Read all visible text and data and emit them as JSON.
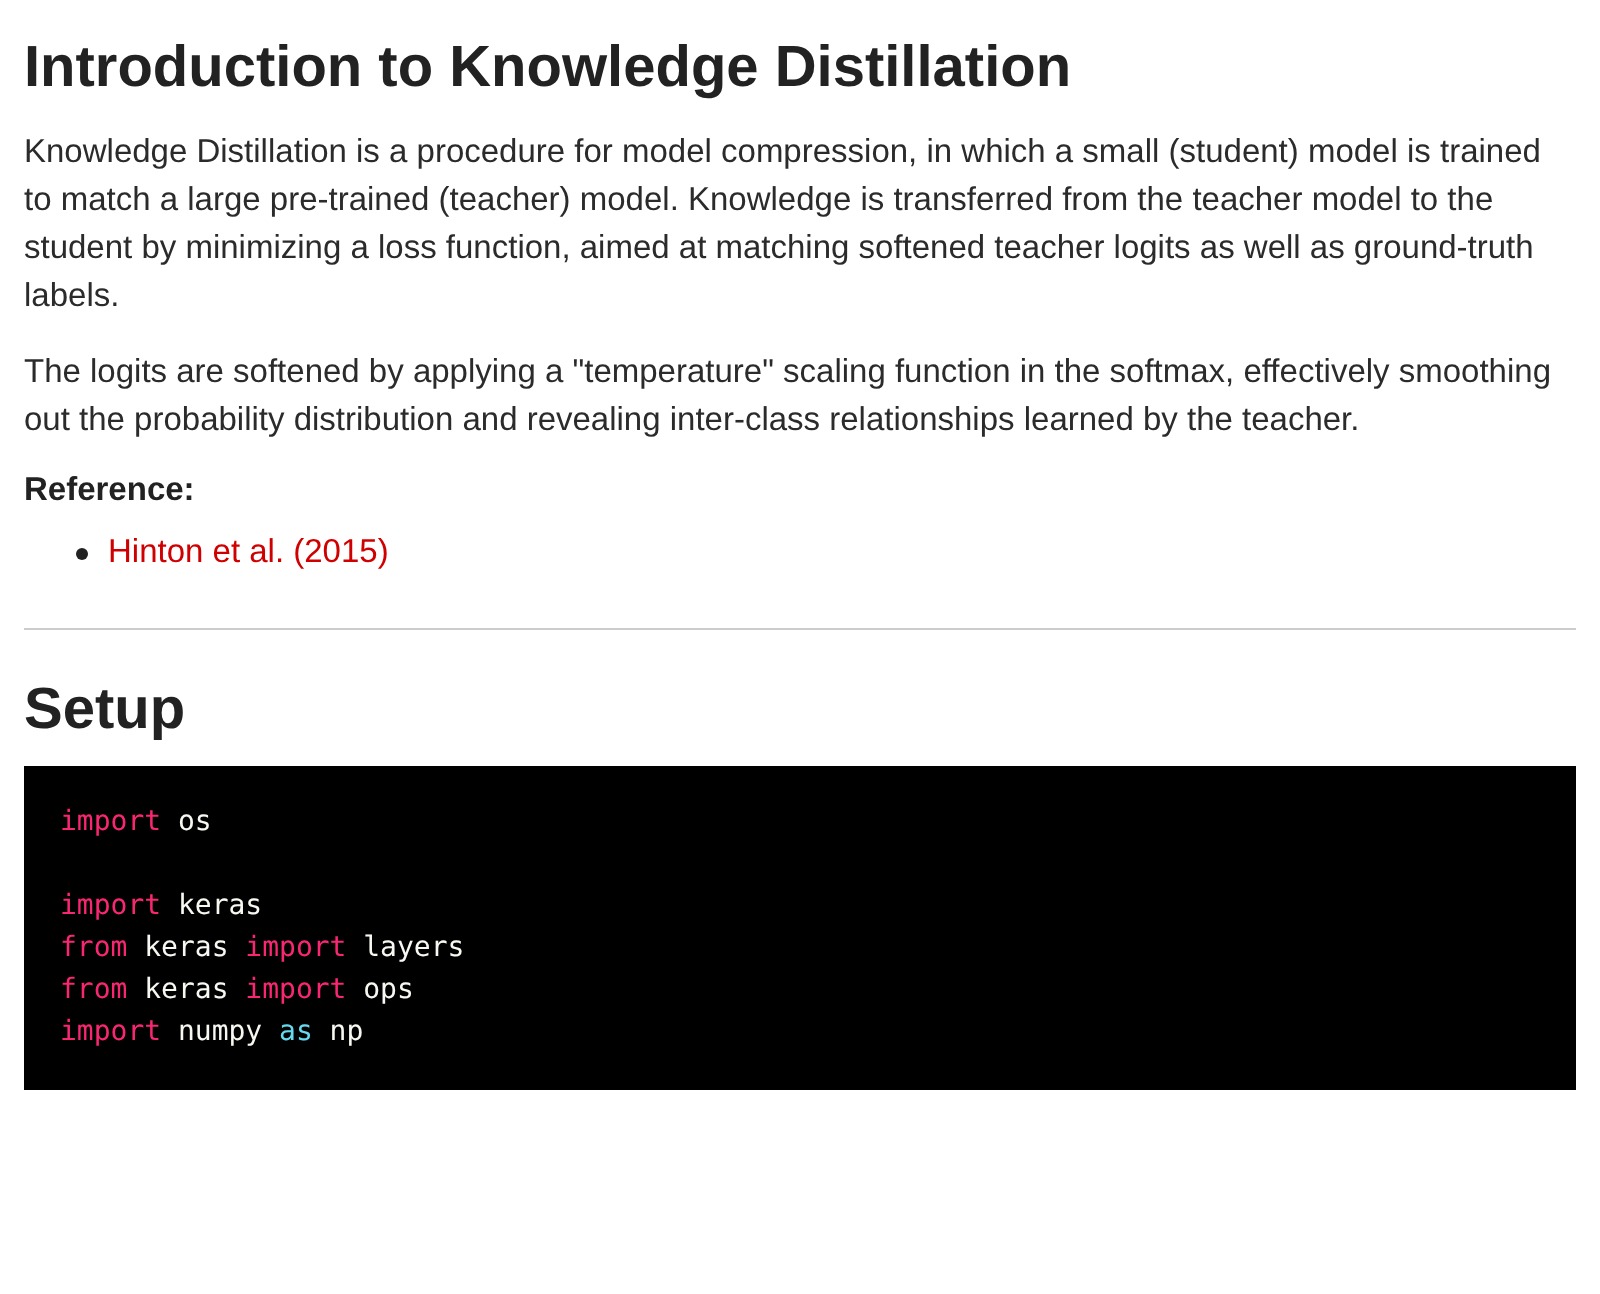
{
  "sections": [
    {
      "heading": "Introduction to Knowledge Distillation",
      "paragraphs": [
        "Knowledge Distillation is a procedure for model compression, in which a small (student) model is trained to match a large pre-trained (teacher) model. Knowledge is transferred from the teacher model to the student by minimizing a loss function, aimed at matching softened teacher logits as well as ground-truth labels.",
        "The logits are softened by applying a \"temperature\" scaling function in the softmax, effectively smoothing out the probability distribution and revealing inter-class relationships learned by the teacher."
      ],
      "reference": {
        "label": "Reference:",
        "links": [
          "Hinton et al. (2015)"
        ]
      }
    },
    {
      "heading": "Setup",
      "code": [
        {
          "kind": "code",
          "tokens": [
            {
              "kind": "keyword",
              "text": "import"
            },
            {
              "kind": "name",
              "text": "os"
            }
          ]
        },
        {
          "kind": "blank"
        },
        {
          "kind": "code",
          "tokens": [
            {
              "kind": "keyword",
              "text": "import"
            },
            {
              "kind": "name",
              "text": "keras"
            }
          ]
        },
        {
          "kind": "code",
          "tokens": [
            {
              "kind": "keyword",
              "text": "from"
            },
            {
              "kind": "name",
              "text": "keras"
            },
            {
              "kind": "keyword",
              "text": "import"
            },
            {
              "kind": "name",
              "text": "layers"
            }
          ]
        },
        {
          "kind": "code",
          "tokens": [
            {
              "kind": "keyword",
              "text": "from"
            },
            {
              "kind": "name",
              "text": "keras"
            },
            {
              "kind": "keyword",
              "text": "import"
            },
            {
              "kind": "name",
              "text": "ops"
            }
          ]
        },
        {
          "kind": "code",
          "tokens": [
            {
              "kind": "keyword",
              "text": "import"
            },
            {
              "kind": "name",
              "text": "numpy"
            },
            {
              "kind": "builtin",
              "text": "as"
            },
            {
              "kind": "name",
              "text": "np"
            }
          ]
        }
      ]
    }
  ]
}
